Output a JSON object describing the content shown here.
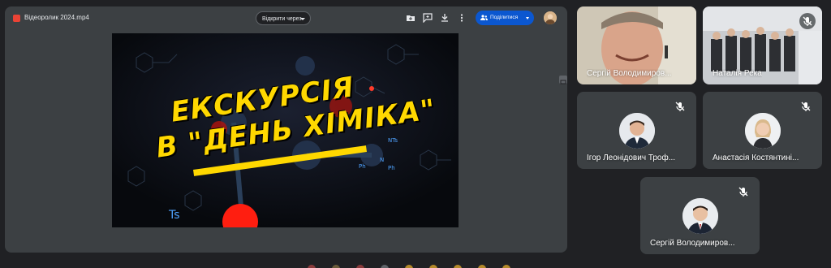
{
  "presentation": {
    "file_name": "Відеоролик 2024.mp4",
    "open_with_label": "Відкрити через",
    "share_label": "Поділитися",
    "video_title_line1": "ЕКСКУРСІЯ",
    "video_title_line2": "В \"ДЕНЬ ХІМІКА\"",
    "video_labels": [
      "NTs",
      "Ph",
      "N",
      "Ph",
      "Ts"
    ]
  },
  "participants": [
    {
      "name": "Сергій Володимиров...",
      "type": "camera"
    },
    {
      "name": "Наталія Река",
      "type": "camera",
      "muted": true
    },
    {
      "name": "Ігор Леонідович Троф...",
      "type": "avatar",
      "muted": true
    },
    {
      "name": "Анастасія Костянтині...",
      "type": "avatar",
      "muted": true
    },
    {
      "name": "Сергій Володимиров...",
      "type": "avatar",
      "muted": true
    }
  ],
  "colors": {
    "background": "#202124",
    "panel": "#3c4043",
    "accent": "#0b57d0",
    "title_yellow": "#ffd800",
    "file_icon_red": "#ea4335"
  }
}
